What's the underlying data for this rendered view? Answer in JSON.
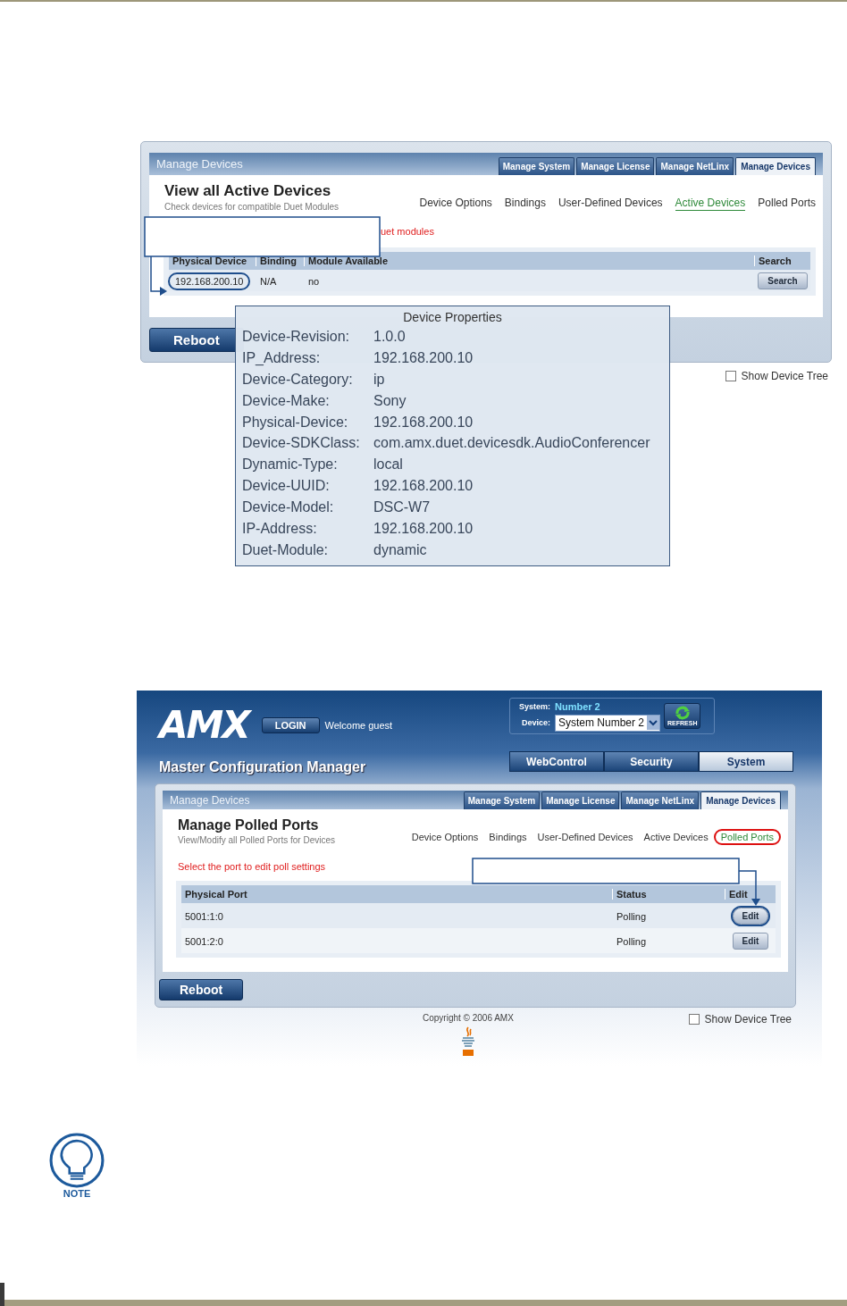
{
  "screens": [
    {
      "kind": "active_devices",
      "panel_title": "Manage Devices",
      "tabs": [
        {
          "label": "Manage System",
          "selected": false
        },
        {
          "label": "Manage License",
          "selected": false
        },
        {
          "label": "Manage NetLinx",
          "selected": false
        },
        {
          "label": "Manage Devices",
          "selected": true
        }
      ],
      "heading": "View all Active Devices",
      "subtitle": "Check devices for compatible Duet Modules",
      "links": [
        {
          "label": "Device Options",
          "selected": false
        },
        {
          "label": "Bindings",
          "selected": false
        },
        {
          "label": "User-Defined Devices",
          "selected": false
        },
        {
          "label": "Active Devices",
          "selected": true
        },
        {
          "label": "Polled Ports",
          "selected": false
        }
      ],
      "message": "uet modules",
      "table": {
        "columns": [
          "Physical Device",
          "Binding",
          "Module Available",
          "Search"
        ],
        "rows": [
          {
            "cells": [
              "192.168.200.10",
              "N/A",
              "no"
            ],
            "button": "Search",
            "circled": true
          }
        ]
      },
      "reboot": "Reboot",
      "show_device_tree": {
        "label": "Show Device Tree",
        "checked": false
      },
      "popup": {
        "title": "Device Properties",
        "properties": [
          {
            "name": "Device-Revision:",
            "value": "1.0.0"
          },
          {
            "name": "IP_Address:",
            "value": "192.168.200.10"
          },
          {
            "name": "Device-Category:",
            "value": "ip"
          },
          {
            "name": "Device-Make:",
            "value": "Sony"
          },
          {
            "name": "Physical-Device:",
            "value": "192.168.200.10"
          },
          {
            "name": "Device-SDKClass:",
            "value": "com.amx.duet.devicesdk.AudioConferencer"
          },
          {
            "name": "Dynamic-Type:",
            "value": "local"
          },
          {
            "name": "Device-UUID:",
            "value": "192.168.200.10"
          },
          {
            "name": "Device-Model:",
            "value": "DSC-W7"
          },
          {
            "name": "IP-Address:",
            "value": "192.168.200.10"
          },
          {
            "name": "Duet-Module:",
            "value": "dynamic"
          }
        ]
      }
    },
    {
      "kind": "polled_ports",
      "header": {
        "logo": "AMX",
        "login": "LOGIN",
        "welcome": "Welcome guest",
        "system_label": "System:",
        "system_value": "Number 2",
        "device_label": "Device:",
        "device_value": "System Number 2",
        "refresh": "REFRESH",
        "app_title": "Master Configuration Manager",
        "nav": [
          {
            "label": "WebControl",
            "selected": false
          },
          {
            "label": "Security",
            "selected": false
          },
          {
            "label": "System",
            "selected": true
          }
        ]
      },
      "panel_title": "Manage Devices",
      "tabs": [
        {
          "label": "Manage System",
          "selected": false
        },
        {
          "label": "Manage License",
          "selected": false
        },
        {
          "label": "Manage NetLinx",
          "selected": false
        },
        {
          "label": "Manage Devices",
          "selected": true
        }
      ],
      "heading": "Manage Polled Ports",
      "subtitle": "View/Modify all Polled Ports for Devices",
      "links": [
        {
          "label": "Device Options",
          "selected": false,
          "circled": false
        },
        {
          "label": "Bindings",
          "selected": false,
          "circled": false
        },
        {
          "label": "User-Defined Devices",
          "selected": false,
          "circled": false
        },
        {
          "label": "Active Devices",
          "selected": false,
          "circled": false
        },
        {
          "label": "Polled Ports",
          "selected": true,
          "circled": true
        }
      ],
      "message": "Select the port to edit poll settings",
      "table": {
        "columns": [
          "Physical Port",
          "Status",
          "Edit"
        ],
        "rows": [
          {
            "cells": [
              "5001:1:0",
              "Polling"
            ],
            "button": "Edit",
            "circled": true
          },
          {
            "cells": [
              "5001:2:0",
              "Polling"
            ],
            "button": "Edit",
            "circled": false
          }
        ]
      },
      "reboot": "Reboot",
      "copyright": "Copyright © 2006 AMX",
      "show_device_tree": {
        "label": "Show Device Tree",
        "checked": false
      }
    }
  ],
  "note": {
    "label": "NOTE"
  }
}
